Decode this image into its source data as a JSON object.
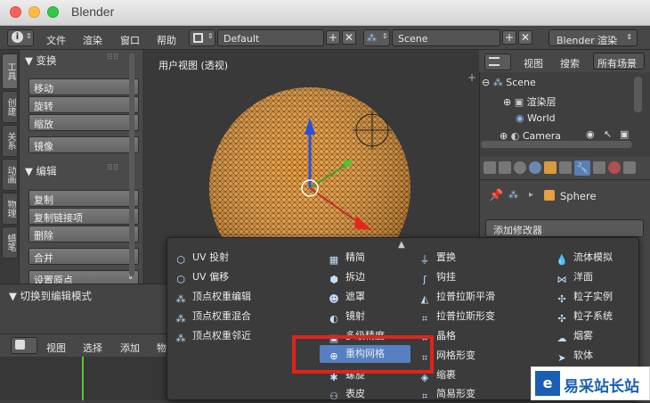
{
  "window": {
    "title": "Blender"
  },
  "topbar": {
    "menus": [
      "文件",
      "渲染",
      "窗口",
      "帮助"
    ],
    "layout": "Default",
    "scene": "Scene",
    "engine": "Blender 渲染"
  },
  "lefttabs": [
    "工具",
    "创建",
    "关系",
    "动画",
    "物理",
    "蜡笔"
  ],
  "toolshelf": {
    "transform_header": "▼ 变换",
    "transform": [
      "移动",
      "旋转",
      "缩放"
    ],
    "mirror": "镜像",
    "edit_header": "▼ 编辑",
    "edit": [
      "复制",
      "复制链接项",
      "删除"
    ],
    "join": "合并",
    "origin": "设置原点"
  },
  "viewport": {
    "label": "用户视图 (透视)"
  },
  "operator": {
    "label": "▼ 切换到编辑模式"
  },
  "bottom_header": {
    "items": [
      "视图",
      "选择",
      "添加",
      "物"
    ]
  },
  "outliner": {
    "header": {
      "view": "视图",
      "search": "搜索",
      "scope": "所有场景"
    },
    "items": [
      "Scene",
      "渲染层",
      "World",
      "Camera"
    ]
  },
  "properties": {
    "object_name": "Sphere",
    "add_modifier": "添加修改器"
  },
  "modifier_menu": {
    "col1": [
      "UV 投射",
      "UV 偏移",
      "顶点权重编辑",
      "顶点权重混合",
      "顶点权重邻近"
    ],
    "col2": [
      "精简",
      "拆边",
      "遮罩",
      "镜射",
      "多级精度",
      "重构网格",
      "螺旋",
      "表皮"
    ],
    "col3": [
      "置换",
      "钩挂",
      "拉普拉斯平滑",
      "拉普拉斯形变",
      "晶格",
      "网格形变",
      "缩裹",
      "简易形变"
    ],
    "col4": [
      "流体模拟",
      "洋面",
      "粒子实例",
      "粒子系统",
      "烟雾",
      "软体"
    ],
    "highlighted": "重构网格"
  },
  "watermark": {
    "text": "易采站长站"
  }
}
